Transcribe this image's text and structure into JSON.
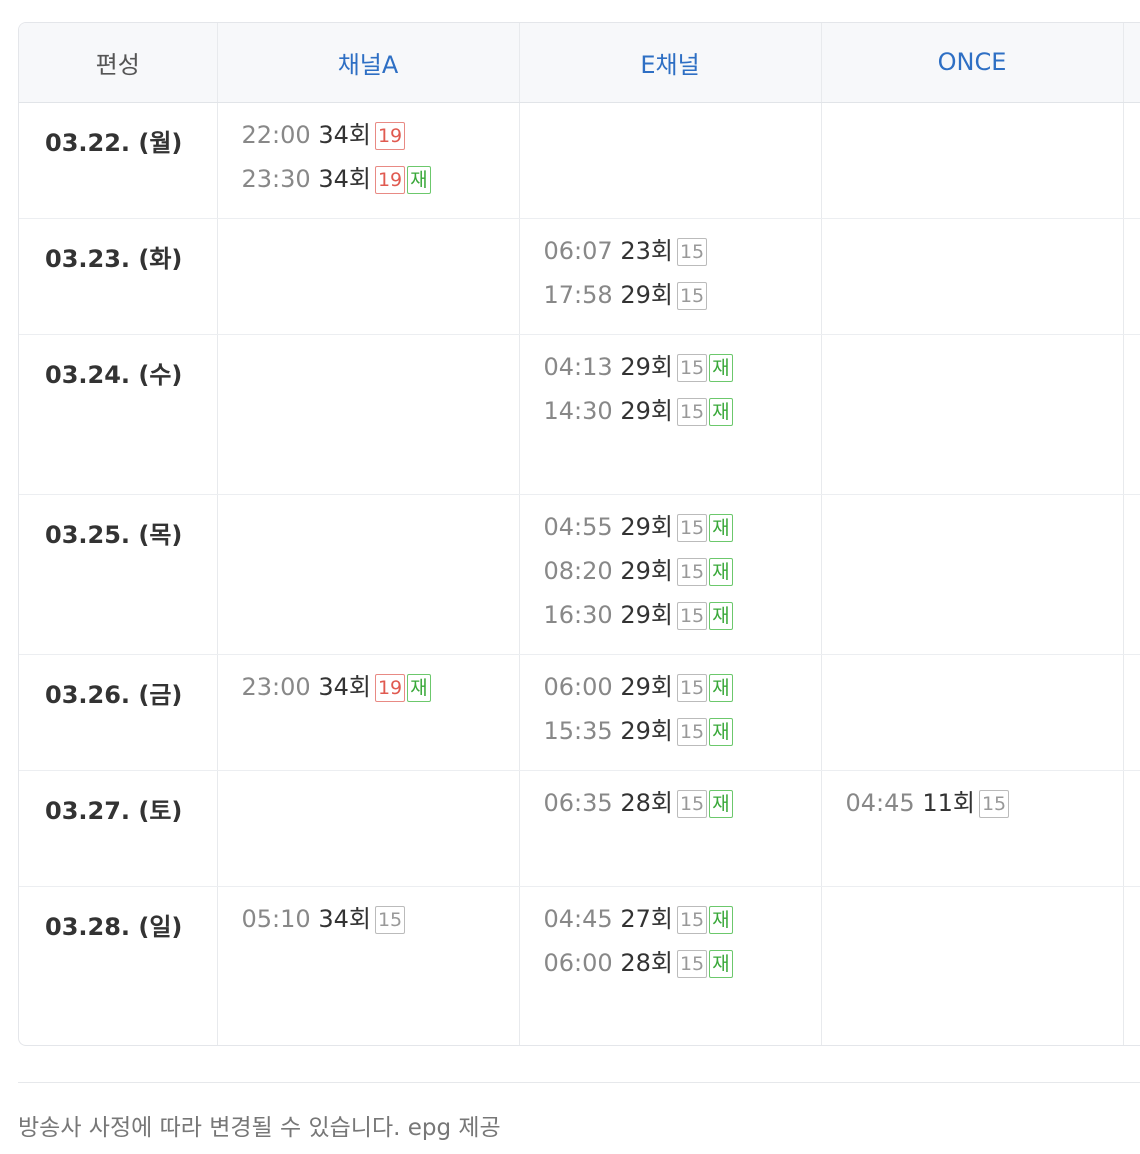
{
  "header": {
    "date_col": "편성",
    "channels": [
      "채널A",
      "E채널",
      "ONCE",
      ""
    ]
  },
  "rows": [
    {
      "date": "03.22. (월)",
      "cells": [
        [
          {
            "time": "22:00",
            "ep": "34회",
            "badges": [
              "19"
            ]
          },
          {
            "time": "23:30",
            "ep": "34회",
            "badges": [
              "19",
              "재"
            ]
          }
        ],
        [],
        [],
        []
      ]
    },
    {
      "date": "03.23. (화)",
      "cells": [
        [],
        [
          {
            "time": "06:07",
            "ep": "23회",
            "badges": [
              "15"
            ]
          },
          {
            "time": "17:58",
            "ep": "29회",
            "badges": [
              "15"
            ]
          }
        ],
        [],
        []
      ]
    },
    {
      "date": "03.24. (수)",
      "cells": [
        [],
        [
          {
            "time": "04:13",
            "ep": "29회",
            "badges": [
              "15",
              "재"
            ]
          },
          {
            "time": "14:30",
            "ep": "29회",
            "badges": [
              "15",
              "재"
            ]
          }
        ],
        [],
        []
      ]
    },
    {
      "date": "03.25. (목)",
      "cells": [
        [],
        [
          {
            "time": "04:55",
            "ep": "29회",
            "badges": [
              "15",
              "재"
            ]
          },
          {
            "time": "08:20",
            "ep": "29회",
            "badges": [
              "15",
              "재"
            ]
          },
          {
            "time": "16:30",
            "ep": "29회",
            "badges": [
              "15",
              "재"
            ]
          }
        ],
        [],
        []
      ]
    },
    {
      "date": "03.26. (금)",
      "cells": [
        [
          {
            "time": "23:00",
            "ep": "34회",
            "badges": [
              "19",
              "재"
            ]
          }
        ],
        [
          {
            "time": "06:00",
            "ep": "29회",
            "badges": [
              "15",
              "재"
            ]
          },
          {
            "time": "15:35",
            "ep": "29회",
            "badges": [
              "15",
              "재"
            ]
          }
        ],
        [],
        []
      ]
    },
    {
      "date": "03.27. (토)",
      "cells": [
        [],
        [
          {
            "time": "06:35",
            "ep": "28회",
            "badges": [
              "15",
              "재"
            ]
          }
        ],
        [
          {
            "time": "04:45",
            "ep": "11회",
            "badges": [
              "15"
            ]
          }
        ],
        []
      ]
    },
    {
      "date": "03.28. (일)",
      "cells": [
        [
          {
            "time": "05:10",
            "ep": "34회",
            "badges": [
              "15"
            ]
          }
        ],
        [
          {
            "time": "04:45",
            "ep": "27회",
            "badges": [
              "15",
              "재"
            ]
          },
          {
            "time": "06:00",
            "ep": "28회",
            "badges": [
              "15",
              "재"
            ]
          }
        ],
        [],
        []
      ]
    }
  ],
  "footer": {
    "note": "방송사 사정에 따라 변경될 수 있습니다. epg 제공"
  },
  "colors": {
    "channel_header": "#2e6fc4",
    "badge_19": "#e05a50",
    "badge_15": "#999999",
    "badge_rerun": "#3aa83a"
  }
}
